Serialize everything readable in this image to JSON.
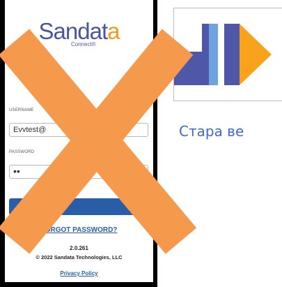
{
  "login": {
    "brand": {
      "prefix": "S",
      "middle": "andat",
      "suffix": "a",
      "sub": "Connect®"
    },
    "username_label": "USERNAME",
    "username_value": "Evvtest@",
    "password_label": "PASSWORD",
    "password_value": "••",
    "forgot_label": "FORGOT PASSWORD?",
    "version": "2.0.261",
    "copyright": "© 2022 Sandata Technologies, LLC",
    "privacy_label": "Privacy Policy"
  },
  "caption": "Стара ве",
  "colors": {
    "cross": "#f5994c",
    "brand_blue": "#4a55a2",
    "brand_orange": "#f49a1e",
    "button_blue": "#2a5da8",
    "caption_blue": "#3d6cc1",
    "logo_orange": "#f9a21b",
    "logo_purple": "#4f58a8"
  },
  "icons": [
    "cross-mark-icon",
    "play-logo-icon"
  ]
}
